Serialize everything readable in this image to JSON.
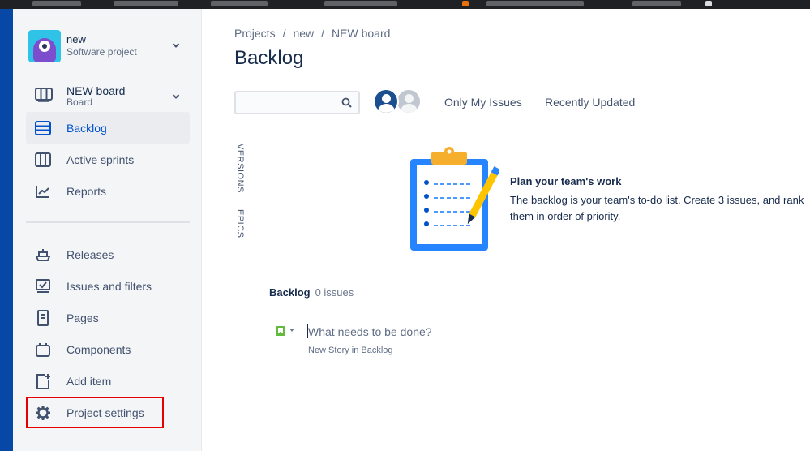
{
  "project": {
    "name": "new",
    "type": "Software project"
  },
  "board": {
    "name": "NEW board",
    "type": "Board"
  },
  "nav": {
    "backlog": "Backlog",
    "active_sprints": "Active sprints",
    "reports": "Reports",
    "releases": "Releases",
    "issues_filters": "Issues and filters",
    "pages": "Pages",
    "components": "Components",
    "add_item": "Add item",
    "project_settings": "Project settings"
  },
  "breadcrumb": {
    "projects": "Projects",
    "project": "new",
    "board": "NEW board",
    "separator": "/"
  },
  "page_title": "Backlog",
  "toolbar": {
    "search_value": "",
    "only_my_issues": "Only My Issues",
    "recently_updated": "Recently Updated"
  },
  "side_tabs": {
    "versions": "VERSIONS",
    "epics": "EPICS"
  },
  "empty_state": {
    "title": "Plan your team's work",
    "description": "The backlog is your team's to-do list. Create 3 issues, and rank them in order of priority."
  },
  "backlog_section": {
    "title": "Backlog",
    "count": "0 issues",
    "create_placeholder": "What needs to be done?",
    "create_hint": "New Story in Backlog"
  },
  "colors": {
    "accent": "#0052cc",
    "nav_dark": "#0747a6",
    "highlight": "#e60000",
    "story": "#63ba3c"
  }
}
